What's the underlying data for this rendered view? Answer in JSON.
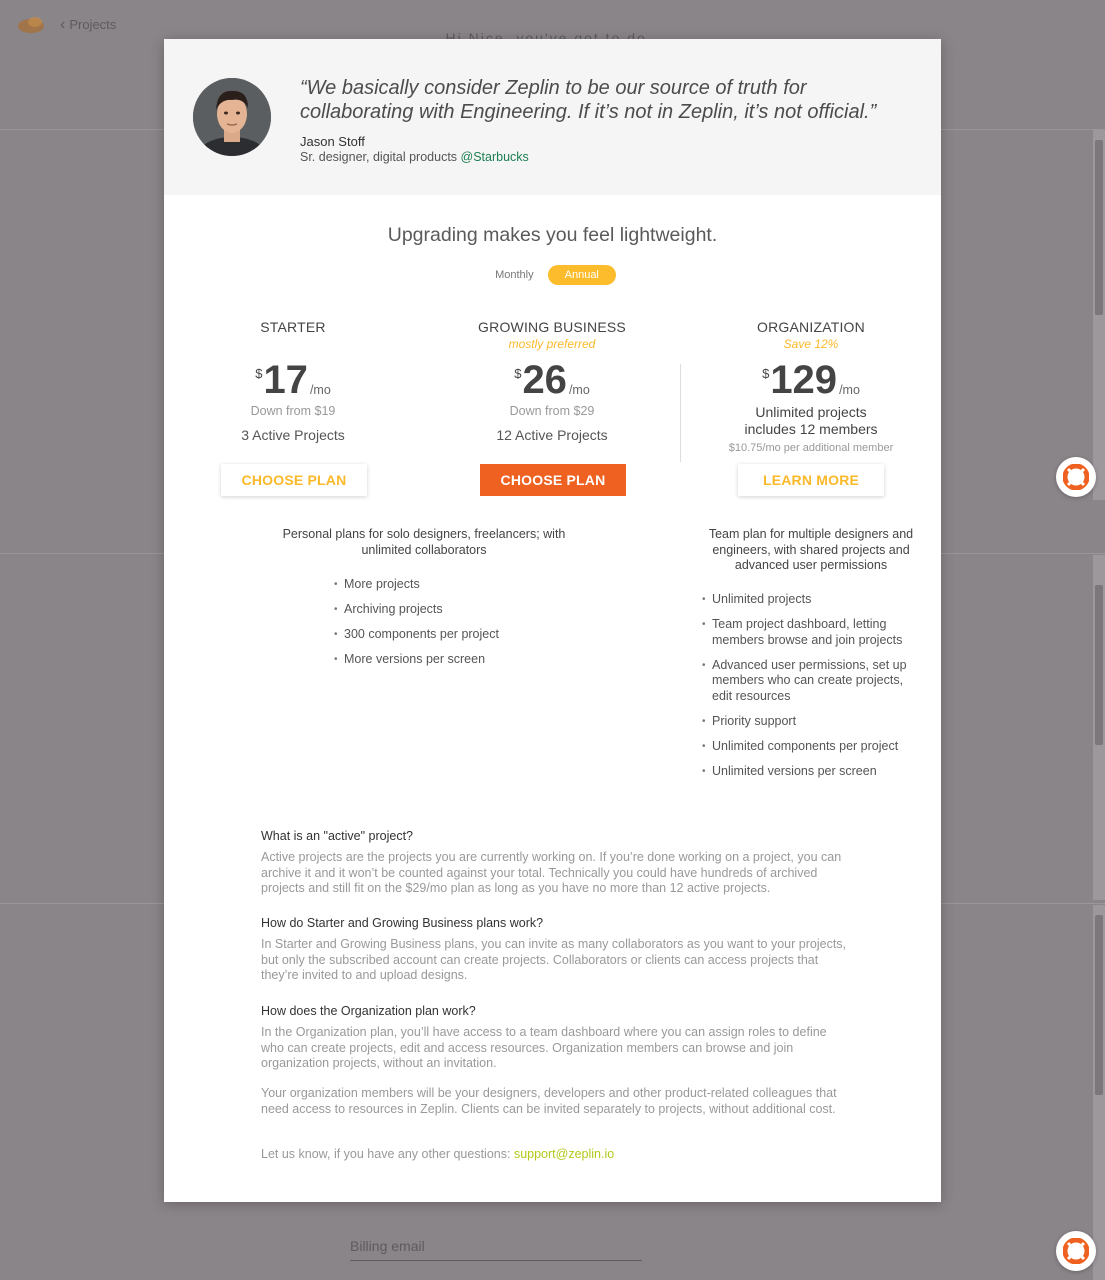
{
  "background": {
    "breadcrumb": "Projects",
    "title_fragment": "Hi Nice, you've got to do...",
    "billing_email_placeholder": "Billing email"
  },
  "testimonial": {
    "quote": "“We basically consider Zeplin to be our source of truth for collaborating with Engineering. If it’s not in Zeplin, it’s not official.”",
    "author": "Jason Stoff",
    "role": "Sr. designer, digital products",
    "company": "@Starbucks"
  },
  "headline": "Upgrading makes you feel lightweight.",
  "billing_toggle": {
    "monthly": "Monthly",
    "annual": "Annual",
    "selected": "Annual"
  },
  "plans": [
    {
      "name": "STARTER",
      "tag": "",
      "currency": "$",
      "price": "17",
      "per": "/mo",
      "was": "Down from $19",
      "projects": "3 Active Projects",
      "button": "CHOOSE PLAN"
    },
    {
      "name": "GROWING BUSINESS",
      "tag": "mostly preferred",
      "currency": "$",
      "price": "26",
      "per": "/mo",
      "was": "Down from $29",
      "projects": "12 Active Projects",
      "button": "CHOOSE PLAN"
    },
    {
      "name": "ORGANIZATION",
      "tag": "Save 12%",
      "currency": "$",
      "price": "129",
      "per": "/mo",
      "line1": "Unlimited projects",
      "line2": "includes 12 members",
      "extra": "$10.75/mo per additional member",
      "button": "LEARN MORE"
    }
  ],
  "personal": {
    "description": "Personal plans for solo designers, freelancers; with unlimited collaborators",
    "features": [
      "More projects",
      "Archiving projects",
      "300 components per project",
      "More versions per screen"
    ]
  },
  "team": {
    "description": "Team plan for multiple designers and engineers, with shared projects and advanced user permissions",
    "features": [
      "Unlimited projects",
      "Team project dashboard, letting members browse and join projects",
      "Advanced user permissions, set up members who can create projects, edit resources",
      "Priority support",
      "Unlimited components per project",
      "Unlimited versions per screen"
    ]
  },
  "faq": [
    {
      "q": "What is an \"active\" project?",
      "a": "Active projects are the projects you are currently working on. If you’re done working on a project, you can archive it and it won’t be counted against your total. Technically you could have hundreds of archived projects and still fit on the $29/mo plan as long as you have no more than 12 active projects."
    },
    {
      "q": "How do Starter and Growing Business plans work?",
      "a": "In Starter and Growing Business plans, you can invite as many collaborators as you want to your projects, but only the subscribed account can create projects. Collaborators or clients can access projects that they’re invited to and upload designs."
    },
    {
      "q": "How does the Organization plan work?",
      "a": "In the Organization plan, you’ll have access to a team dashboard where you can assign roles to define who can create projects, edit and access resources. Organization members can browse and join organization projects, without an invitation."
    }
  ],
  "faq_extra": "Your organization members will be your designers, developers and other product-related colleagues that need access to resources in Zeplin. Clients can be invited separately to projects, without additional cost.",
  "contact": {
    "text": "Let us know, if you have any other questions:",
    "email": "support@zeplin.io"
  },
  "colors": {
    "accent_orange": "#ee6120",
    "accent_yellow": "#fbb92a",
    "link_green": "#1b7f52",
    "mail_lime": "#b5c91b"
  }
}
